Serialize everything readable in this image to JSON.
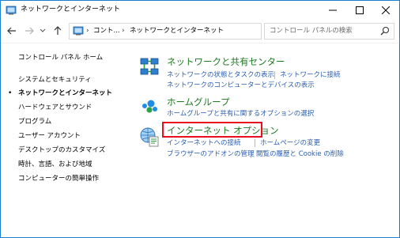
{
  "window": {
    "title": "ネットワークとインターネット",
    "title_icon": "control-panel-icon"
  },
  "address_bar": {
    "crumbs": [
      "コント...",
      "ネットワークとインターネット"
    ],
    "separator": "›"
  },
  "search": {
    "placeholder": "コントロール パネルの検索"
  },
  "sidebar": {
    "home_label": "コントロール パネル ホーム",
    "items": [
      {
        "label": "システムとセキュリティ",
        "active": false
      },
      {
        "label": "ネットワークとインターネット",
        "active": true
      },
      {
        "label": "ハードウェアとサウンド",
        "active": false
      },
      {
        "label": "プログラム",
        "active": false
      },
      {
        "label": "ユーザー アカウント",
        "active": false
      },
      {
        "label": "デスクトップのカスタマイズ",
        "active": false
      },
      {
        "label": "時計、言語、および地域",
        "active": false
      },
      {
        "label": "コンピューターの簡単操作",
        "active": false
      }
    ]
  },
  "categories": [
    {
      "title": "ネットワークと共有センター",
      "icon": "network-sharing-center-icon",
      "links": [
        "ネットワークの状態とタスクの表示",
        "ネットワークに接続",
        "ネットワークのコンピューターとデバイスの表示"
      ]
    },
    {
      "title": "ホームグループ",
      "icon": "homegroup-icon",
      "links": [
        "ホームグループと共有に関するオプションの選択"
      ]
    },
    {
      "title": "インターネット オプション",
      "icon": "internet-options-icon",
      "links": [
        "インターネットへの接続",
        "ホームページの変更",
        "ブラウザーのアドオンの管理",
        "閲覧の履歴と Cookie の削除"
      ]
    }
  ],
  "colors": {
    "window_border": "#1a7fcf",
    "category_title": "#1e7a20",
    "link": "#2a5db0",
    "highlight_box": "#e8101f"
  }
}
